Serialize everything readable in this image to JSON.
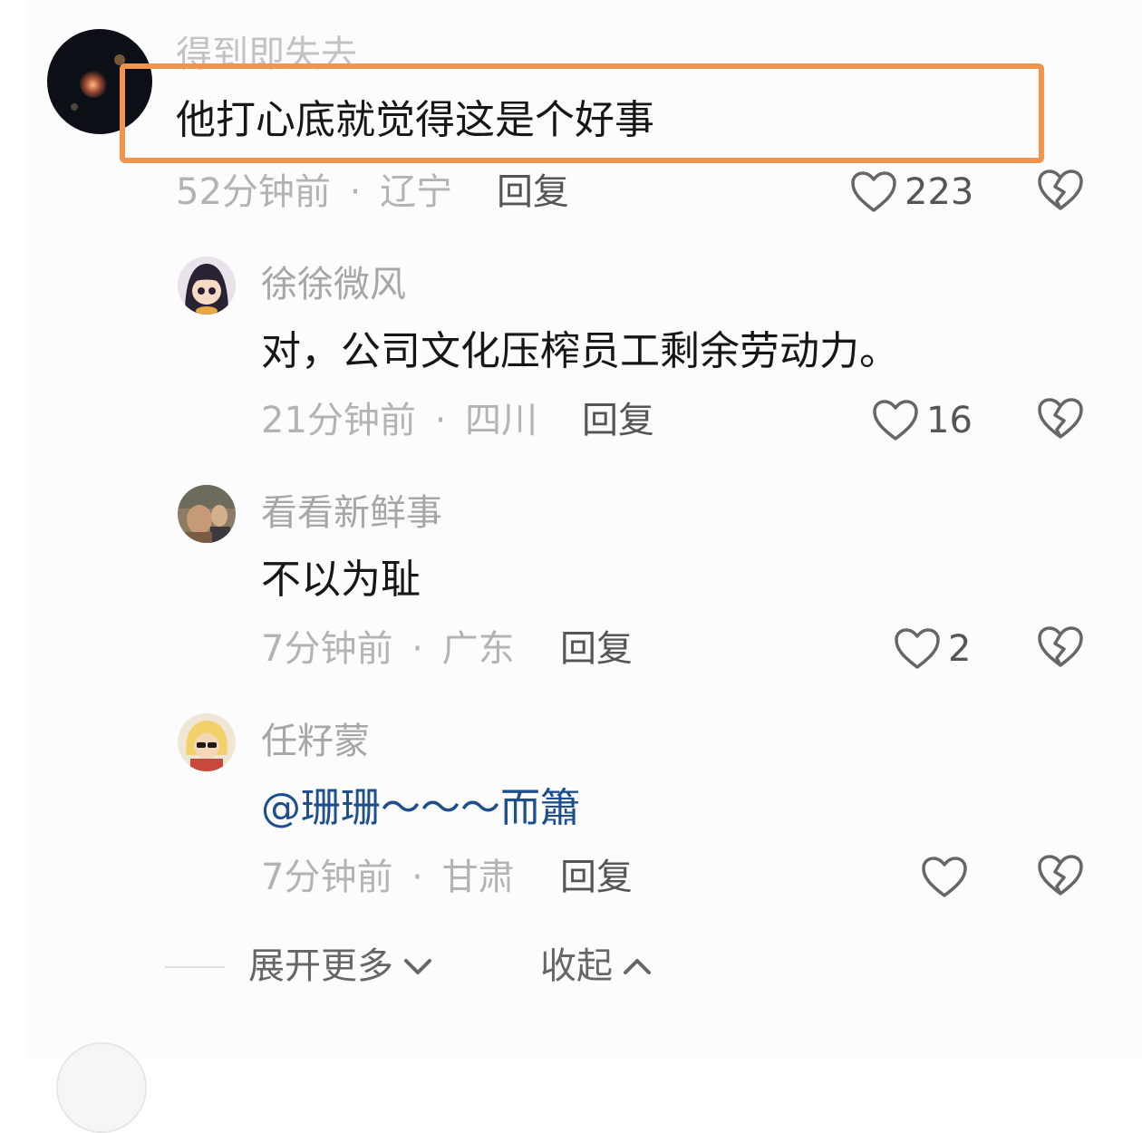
{
  "comments": [
    {
      "username": "得到即失去",
      "text": "他打心底就觉得这是个好事",
      "time": "52分钟前",
      "location": "辽宁",
      "reply_label": "回复",
      "likes": "223",
      "highlighted": true
    },
    {
      "username": "徐徐微风",
      "text": "对，公司文化压榨员工剩余劳动力。",
      "time": "21分钟前",
      "location": "四川",
      "reply_label": "回复",
      "likes": "16"
    },
    {
      "username": "看看新鲜事",
      "text": "不以为耻",
      "time": "7分钟前",
      "location": "广东",
      "reply_label": "回复",
      "likes": "2"
    },
    {
      "username": "任籽蒙",
      "text": "@珊珊～～～而簫",
      "time": "7分钟前",
      "location": "甘肃",
      "reply_label": "回复",
      "likes": ""
    }
  ],
  "separator": "·",
  "footer": {
    "expand_label": "展开更多",
    "collapse_label": "收起"
  },
  "colors": {
    "highlight_border": "#f2944c",
    "mention": "#1d4f8c",
    "muted_text": "#b3b3b3"
  },
  "icons": [
    "heart-outline-icon",
    "broken-heart-icon",
    "chevron-down-icon",
    "chevron-up-icon"
  ]
}
